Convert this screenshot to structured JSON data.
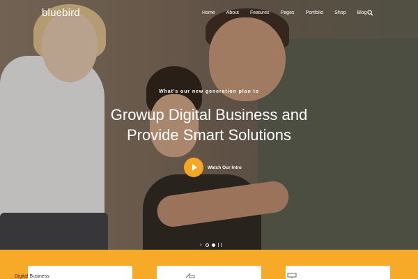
{
  "brand": {
    "logo_text": "bluebird"
  },
  "nav": {
    "items": [
      {
        "label": "Home"
      },
      {
        "label": "About"
      },
      {
        "label": "Features"
      },
      {
        "label": "Pages"
      },
      {
        "label": "Portfolio"
      },
      {
        "label": "Shop"
      },
      {
        "label": "Blog"
      }
    ],
    "search_icon": "search-icon"
  },
  "hero": {
    "eyebrow": "What's our new generation plan to",
    "title_line1": "Growup Digital Business and",
    "title_line2": "Provide Smart Solutions",
    "video_label": "Watch Our Intro",
    "accent_color": "#f5a623"
  },
  "slider": {
    "slides": 2,
    "active_index": 1
  },
  "features": {
    "band_color": "#f7a928",
    "items": [
      {
        "title": "Digital Business",
        "icon": "business-icon"
      },
      {
        "title": "",
        "icon": "pencil-ruler-icon"
      },
      {
        "title": "",
        "icon": "presentation-board-icon"
      }
    ]
  }
}
